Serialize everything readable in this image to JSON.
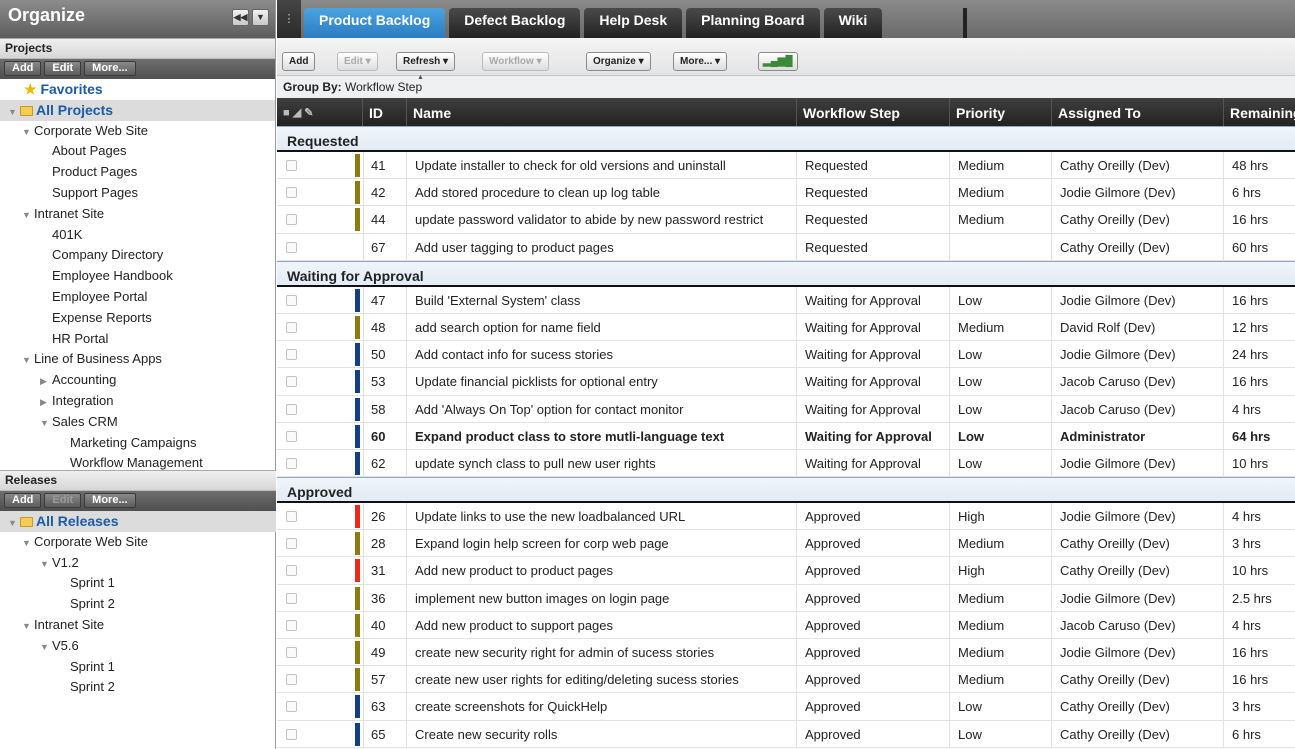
{
  "sidebar": {
    "title": "Organize",
    "projects_header": "Projects",
    "projects_buttons": [
      "Add",
      "Edit",
      "More..."
    ],
    "favorites": "Favorites",
    "all_projects": "All Projects",
    "projects_tree": [
      {
        "label": "Corporate Web Site",
        "level": 1,
        "twisty": "▼"
      },
      {
        "label": "About Pages",
        "level": 2,
        "twisty": ""
      },
      {
        "label": "Product Pages",
        "level": 2,
        "twisty": ""
      },
      {
        "label": "Support Pages",
        "level": 2,
        "twisty": ""
      },
      {
        "label": "Intranet Site",
        "level": 1,
        "twisty": "▼"
      },
      {
        "label": "401K",
        "level": 2,
        "twisty": ""
      },
      {
        "label": "Company Directory",
        "level": 2,
        "twisty": ""
      },
      {
        "label": "Employee Handbook",
        "level": 2,
        "twisty": ""
      },
      {
        "label": "Employee Portal",
        "level": 2,
        "twisty": ""
      },
      {
        "label": "Expense Reports",
        "level": 2,
        "twisty": ""
      },
      {
        "label": "HR Portal",
        "level": 2,
        "twisty": ""
      },
      {
        "label": "Line of Business Apps",
        "level": 1,
        "twisty": "▼"
      },
      {
        "label": "Accounting",
        "level": 2,
        "twisty": "▶"
      },
      {
        "label": "Integration",
        "level": 2,
        "twisty": "▶"
      },
      {
        "label": "Sales CRM",
        "level": 2,
        "twisty": "▼"
      },
      {
        "label": "Marketing Campaigns",
        "level": 3,
        "twisty": ""
      },
      {
        "label": "Workflow Management",
        "level": 3,
        "twisty": ""
      }
    ],
    "releases_header": "Releases",
    "releases_buttons": [
      "Add",
      "Edit",
      "More..."
    ],
    "all_releases": "All Releases",
    "releases_tree": [
      {
        "label": "Corporate Web Site",
        "level": 1,
        "twisty": "▼"
      },
      {
        "label": "V1.2",
        "level": 2,
        "twisty": "▼"
      },
      {
        "label": "Sprint 1",
        "level": 3,
        "twisty": ""
      },
      {
        "label": "Sprint 2",
        "level": 3,
        "twisty": ""
      },
      {
        "label": "Intranet Site",
        "level": 1,
        "twisty": "▼"
      },
      {
        "label": "V5.6",
        "level": 2,
        "twisty": "▼"
      },
      {
        "label": "Sprint 1",
        "level": 3,
        "twisty": ""
      },
      {
        "label": "Sprint 2",
        "level": 3,
        "twisty": ""
      }
    ]
  },
  "tabs": [
    "Product Backlog",
    "Defect Backlog",
    "Help Desk",
    "Planning Board",
    "Wiki"
  ],
  "active_tab": "Product Backlog",
  "toolbar": {
    "add": "Add",
    "edit": "Edit ▾",
    "refresh": "Refresh ▾",
    "workflow": "Workflow ▾",
    "organize": "Organize ▾",
    "more": "More... ▾"
  },
  "group_by": {
    "label": "Group By:",
    "value": "Workflow Step"
  },
  "columns": {
    "id": "ID",
    "name": "Name",
    "workflow": "Workflow Step",
    "priority": "Priority",
    "assigned": "Assigned To",
    "remaining": "Remaining"
  },
  "colors": {
    "medium": "#8e7a10",
    "low": "#133f86",
    "high": "#ea2a1a"
  },
  "groups": [
    {
      "title": "Requested",
      "rows": [
        {
          "id": "41",
          "name": "Update installer to check for old versions and uninstall",
          "step": "Requested",
          "priority": "Medium",
          "assigned": "Cathy Oreilly (Dev)",
          "remaining": "48 hrs",
          "color": "#8e7a10"
        },
        {
          "id": "42",
          "name": "Add stored procedure to clean up log table",
          "step": "Requested",
          "priority": "Medium",
          "assigned": "Jodie Gilmore (Dev)",
          "remaining": "6 hrs",
          "color": "#8e7a10"
        },
        {
          "id": "44",
          "name": "update password validator to abide by new password restrict",
          "step": "Requested",
          "priority": "Medium",
          "assigned": "Cathy Oreilly (Dev)",
          "remaining": "16 hrs",
          "color": "#8e7a10"
        },
        {
          "id": "67",
          "name": "Add user tagging to product pages",
          "step": "Requested",
          "priority": "",
          "assigned": "Cathy Oreilly (Dev)",
          "remaining": "60 hrs",
          "color": ""
        }
      ]
    },
    {
      "title": "Waiting for Approval",
      "rows": [
        {
          "id": "47",
          "name": "Build 'External System' class",
          "step": "Waiting for Approval",
          "priority": "Low",
          "assigned": "Jodie Gilmore (Dev)",
          "remaining": "16 hrs",
          "color": "#133f86"
        },
        {
          "id": "48",
          "name": "add search option for name field",
          "step": "Waiting for Approval",
          "priority": "Medium",
          "assigned": "David Rolf (Dev)",
          "remaining": "12 hrs",
          "color": "#8e7a10"
        },
        {
          "id": "50",
          "name": "Add contact info for sucess stories",
          "step": "Waiting for Approval",
          "priority": "Low",
          "assigned": "Jodie Gilmore (Dev)",
          "remaining": "24 hrs",
          "color": "#133f86"
        },
        {
          "id": "53",
          "name": "Update financial picklists for optional entry",
          "step": "Waiting for Approval",
          "priority": "Low",
          "assigned": "Jacob Caruso (Dev)",
          "remaining": "16 hrs",
          "color": "#133f86"
        },
        {
          "id": "58",
          "name": "Add 'Always On Top' option for contact monitor",
          "step": "Waiting for Approval",
          "priority": "Low",
          "assigned": "Jacob Caruso (Dev)",
          "remaining": "4 hrs",
          "color": "#133f86"
        },
        {
          "id": "60",
          "name": "Expand product class to store mutli-language text",
          "step": "Waiting for Approval",
          "priority": "Low",
          "assigned": "Administrator",
          "remaining": "64 hrs",
          "color": "#133f86",
          "bold": true
        },
        {
          "id": "62",
          "name": "update synch class to pull new user rights",
          "step": "Waiting for Approval",
          "priority": "Low",
          "assigned": "Jodie Gilmore (Dev)",
          "remaining": "10 hrs",
          "color": "#133f86"
        }
      ]
    },
    {
      "title": "Approved",
      "rows": [
        {
          "id": "26",
          "name": "Update links to use the new loadbalanced URL",
          "step": "Approved",
          "priority": "High",
          "assigned": "Jodie Gilmore (Dev)",
          "remaining": "4 hrs",
          "color": "#ea2a1a"
        },
        {
          "id": "28",
          "name": "Expand login help screen for corp web page",
          "step": "Approved",
          "priority": "Medium",
          "assigned": "Cathy Oreilly (Dev)",
          "remaining": "3 hrs",
          "color": "#8e7a10"
        },
        {
          "id": "31",
          "name": "Add new product to product pages",
          "step": "Approved",
          "priority": "High",
          "assigned": "Cathy Oreilly (Dev)",
          "remaining": "10 hrs",
          "color": "#ea2a1a"
        },
        {
          "id": "36",
          "name": "implement new button images on login page",
          "step": "Approved",
          "priority": "Medium",
          "assigned": "Jodie Gilmore (Dev)",
          "remaining": "2.5 hrs",
          "color": "#8e7a10"
        },
        {
          "id": "40",
          "name": "Add new product to support pages",
          "step": "Approved",
          "priority": "Medium",
          "assigned": "Jacob Caruso (Dev)",
          "remaining": "4 hrs",
          "color": "#8e7a10"
        },
        {
          "id": "49",
          "name": "create new security right for admin of sucess stories",
          "step": "Approved",
          "priority": "Medium",
          "assigned": "Jodie Gilmore (Dev)",
          "remaining": "16 hrs",
          "color": "#8e7a10"
        },
        {
          "id": "57",
          "name": "create new user rights for editing/deleting sucess stories",
          "step": "Approved",
          "priority": "Medium",
          "assigned": "Cathy Oreilly (Dev)",
          "remaining": "16 hrs",
          "color": "#8e7a10"
        },
        {
          "id": "63",
          "name": "create screenshots for QuickHelp",
          "step": "Approved",
          "priority": "Low",
          "assigned": "Cathy Oreilly (Dev)",
          "remaining": "3 hrs",
          "color": "#133f86"
        },
        {
          "id": "65",
          "name": "Create new security rolls",
          "step": "Approved",
          "priority": "Low",
          "assigned": "Cathy Oreilly (Dev)",
          "remaining": "6 hrs",
          "color": "#133f86"
        }
      ]
    }
  ]
}
